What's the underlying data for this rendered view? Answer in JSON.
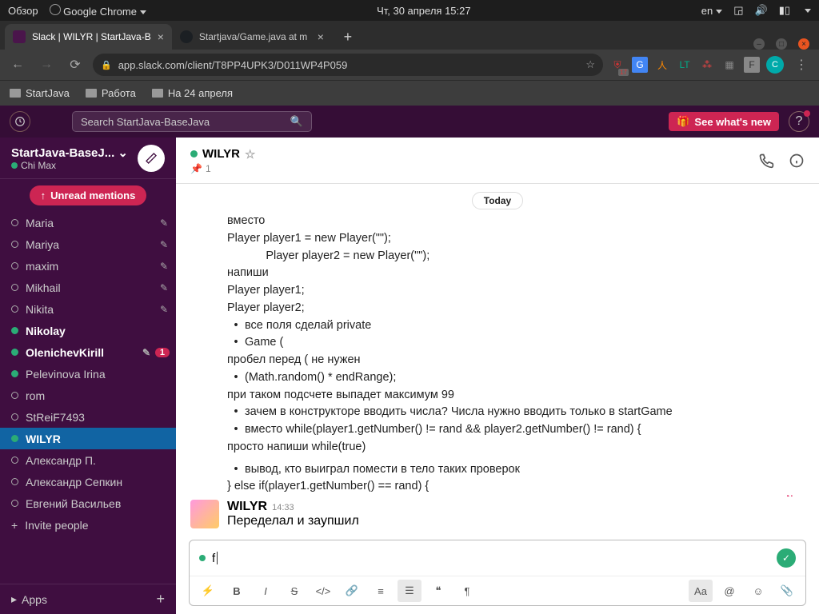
{
  "sysbar": {
    "overview": "Обзор",
    "browser": "Google Chrome",
    "datetime": "Чт, 30 апреля  15:27",
    "lang": "en"
  },
  "tabs": [
    {
      "title": "Slack | WILYR | StartJava-B",
      "favicon": "#4A154B"
    },
    {
      "title": "Startjava/Game.java at m",
      "favicon": "#1b1f23"
    }
  ],
  "url": "app.slack.com/client/T8PP4UPK3/D011WP4P059",
  "ext_badge": "17",
  "avatar_initial": "C",
  "bookmarks": [
    "StartJava",
    "Работа",
    "На 24 апреля"
  ],
  "slack": {
    "search_ph": "Search StartJava-BaseJava",
    "whatsnew": "See what's new",
    "workspace": "StartJava-BaseJ...",
    "user": "Chi Max",
    "unread_pill": "Unread mentions",
    "dms": [
      {
        "name": "Maria",
        "online": false
      },
      {
        "name": "Mariya",
        "online": false
      },
      {
        "name": "maxim",
        "online": false
      },
      {
        "name": "Mikhail",
        "online": false
      },
      {
        "name": "Nikita",
        "online": false
      },
      {
        "name": "Nikolay",
        "online": true,
        "bold": true
      },
      {
        "name": "OlenichevKirill",
        "online": true,
        "bold": true,
        "badge": "1"
      },
      {
        "name": "Pelevinova Irina",
        "online": true
      },
      {
        "name": "rom",
        "online": false
      },
      {
        "name": "StReiF7493",
        "online": false
      },
      {
        "name": "WILYR",
        "online": true,
        "bold": true,
        "selected": true
      },
      {
        "name": "Александр П.",
        "online": false
      },
      {
        "name": "Александр Сепкин",
        "online": false
      },
      {
        "name": "Евгений Васильев",
        "online": false
      }
    ],
    "invite": "Invite people",
    "apps": "Apps"
  },
  "channel": {
    "name": "WILYR",
    "pins": "1",
    "today": "Today",
    "new_label": "New"
  },
  "msg1": {
    "l1": "вместо",
    "l2": "Player player1 = new Player(\"\");",
    "l3": "            Player player2 = new Player(\"\");",
    "l4": "напиши",
    "l5": "Player player1;",
    "l6": "Player player2;",
    "b1": "все поля сделай private",
    "b2": "Game (",
    "l7": "пробел перед ( не нужен",
    "b3": "(Math.random() * endRange);",
    "l8": "при таком подсчете выпадет максимум 99",
    "b4": "зачем в конструкторе вводить числа? Числа нужно вводить только в startGame",
    "b5": "вместо while(player1.getNumber() != rand && player2.getNumber() != rand) {",
    "l9": "просто напиши while(true)",
    "b6": "вывод, кто выиграл помести в тело таких проверок",
    "l10": "} else if(player1.getNumber() == rand) {"
  },
  "msg2": {
    "author": "WILYR",
    "time": "14:33",
    "text": "Переделал и заупшил"
  },
  "composer": {
    "value": "f",
    "aa": "Aa"
  }
}
